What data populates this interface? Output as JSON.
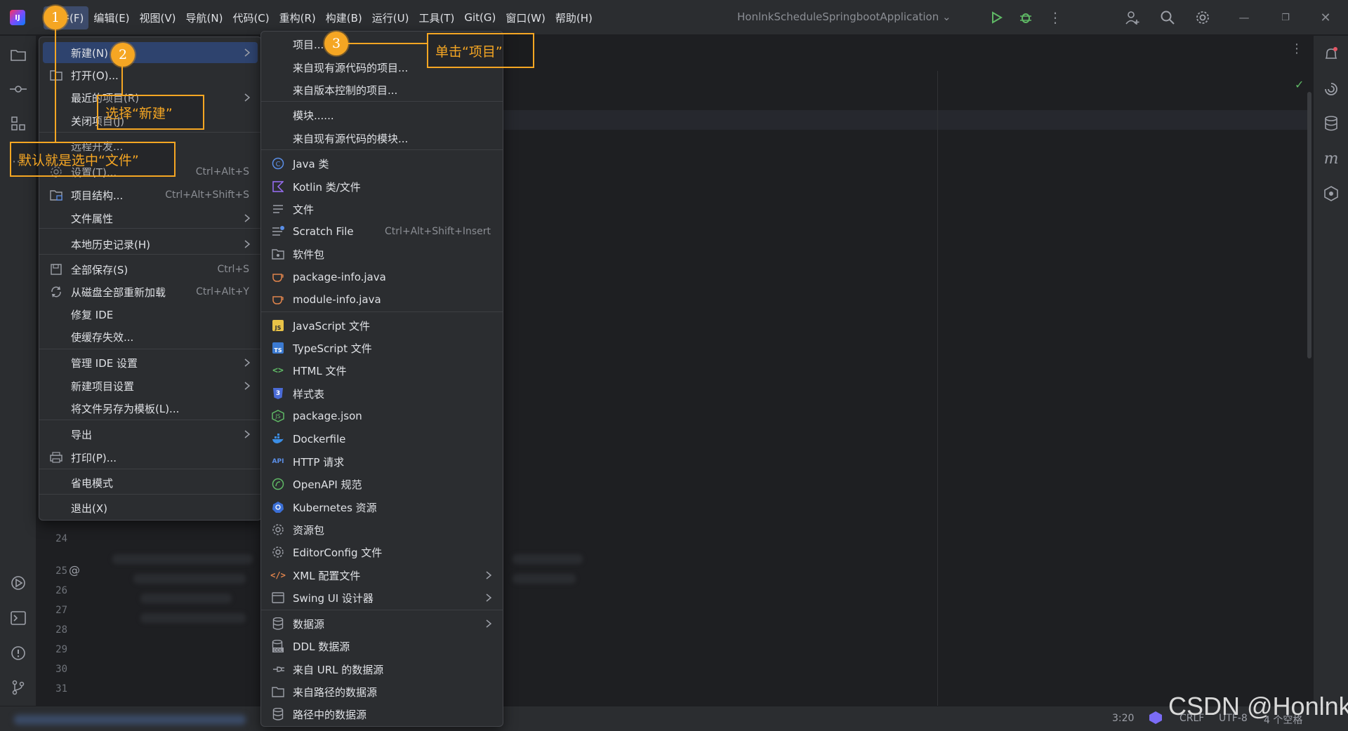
{
  "titlebar": {
    "menu": [
      "文件(F)",
      "编辑(E)",
      "视图(V)",
      "导航(N)",
      "代码(C)",
      "重构(R)",
      "构建(B)",
      "运行(U)",
      "工具(T)",
      "Git(G)",
      "窗口(W)",
      "帮助(H)"
    ],
    "run_config": "HonlnkScheduleSpringbootApplication",
    "icons": [
      "app-logo-icon",
      "run-icon",
      "debug-icon",
      "more-icon",
      "add-user-icon",
      "search-icon",
      "settings-icon",
      "minimize-icon",
      "restore-icon",
      "close-icon"
    ]
  },
  "file_menu": {
    "items": [
      {
        "label": "新建(N)",
        "submenu": true,
        "selected": true
      },
      {
        "label": "打开(O)...",
        "icon": "folder-icon"
      },
      {
        "label": "最近的项目(R)",
        "submenu": true
      },
      {
        "label": "关闭项目(J)"
      },
      {
        "label": "远程开发..."
      },
      {
        "label": "设置(T)...",
        "shortcut": "Ctrl+Alt+S",
        "icon": "gear-icon"
      },
      {
        "label": "项目结构...",
        "shortcut": "Ctrl+Alt+Shift+S",
        "icon": "project-structure-icon"
      },
      {
        "label": "文件属性",
        "submenu": true
      },
      {
        "label": "本地历史记录(H)",
        "submenu": true
      },
      {
        "label": "全部保存(S)",
        "shortcut": "Ctrl+S",
        "icon": "save-icon"
      },
      {
        "label": "从磁盘全部重新加载",
        "shortcut": "Ctrl+Alt+Y",
        "icon": "reload-icon"
      },
      {
        "label": "修复 IDE"
      },
      {
        "label": "使缓存失效..."
      },
      {
        "label": "管理 IDE 设置",
        "submenu": true
      },
      {
        "label": "新建项目设置",
        "submenu": true
      },
      {
        "label": "将文件另存为模板(L)..."
      },
      {
        "label": "导出",
        "submenu": true
      },
      {
        "label": "打印(P)...",
        "icon": "print-icon"
      },
      {
        "label": "省电模式"
      },
      {
        "label": "退出(X)"
      }
    ]
  },
  "new_submenu": {
    "items": [
      {
        "label": "项目..."
      },
      {
        "label": "来自现有源代码的项目..."
      },
      {
        "label": "来自版本控制的项目..."
      },
      {
        "label": "模块......"
      },
      {
        "label": "来自现有源代码的模块..."
      },
      {
        "label": "Java 类",
        "icon": "java-class-icon"
      },
      {
        "label": "Kotlin 类/文件",
        "icon": "kotlin-icon"
      },
      {
        "label": "文件",
        "icon": "file-icon"
      },
      {
        "label": "Scratch File",
        "shortcut": "Ctrl+Alt+Shift+Insert",
        "icon": "scratch-file-icon"
      },
      {
        "label": "软件包",
        "icon": "package-icon"
      },
      {
        "label": "package-info.java",
        "icon": "java-file-icon"
      },
      {
        "label": "module-info.java",
        "icon": "java-file-icon"
      },
      {
        "label": "JavaScript 文件",
        "icon": "javascript-icon"
      },
      {
        "label": "TypeScript 文件",
        "icon": "typescript-icon"
      },
      {
        "label": "HTML 文件",
        "icon": "html-icon"
      },
      {
        "label": "样式表",
        "icon": "css-icon"
      },
      {
        "label": "package.json",
        "icon": "npm-icon"
      },
      {
        "label": "Dockerfile",
        "icon": "docker-icon"
      },
      {
        "label": "HTTP 请求",
        "icon": "api-icon"
      },
      {
        "label": "OpenAPI 规范",
        "icon": "openapi-icon"
      },
      {
        "label": "Kubernetes 资源",
        "icon": "kubernetes-icon"
      },
      {
        "label": "资源包",
        "icon": "resource-bundle-icon"
      },
      {
        "label": "EditorConfig 文件",
        "icon": "editorconfig-icon"
      },
      {
        "label": "XML 配置文件",
        "submenu": true,
        "icon": "xml-icon"
      },
      {
        "label": "Swing UI 设计器",
        "submenu": true,
        "icon": "swing-icon"
      },
      {
        "label": "数据源",
        "submenu": true,
        "icon": "database-icon"
      },
      {
        "label": "DDL 数据源",
        "icon": "ddl-icon"
      },
      {
        "label": "来自 URL 的数据源",
        "icon": "url-datasource-icon"
      },
      {
        "label": "来自路径的数据源",
        "icon": "folder-icon"
      },
      {
        "label": "路径中的数据源",
        "icon": "database-icon"
      }
    ]
  },
  "annotations": {
    "badges": [
      "1",
      "2",
      "3"
    ],
    "callouts": {
      "c1": "默认就是选中“文件”",
      "c2": "选择“新建”",
      "c3": "单击“项目”"
    }
  },
  "editor": {
    "line_numbers": [
      "24",
      "25",
      "26",
      "27",
      "28",
      "29",
      "30",
      "31"
    ],
    "gutter_at": "@"
  },
  "statusbar": {
    "position": "3:20",
    "line_ending": "CRLF",
    "encoding": "UTF-8",
    "indent": "4 个空格"
  },
  "watermark": "CSDN @Honlnk",
  "colors": {
    "accent": "#f5a623",
    "selection": "#2e436e",
    "background": "#1e1f22",
    "panel": "#2b2d30"
  }
}
